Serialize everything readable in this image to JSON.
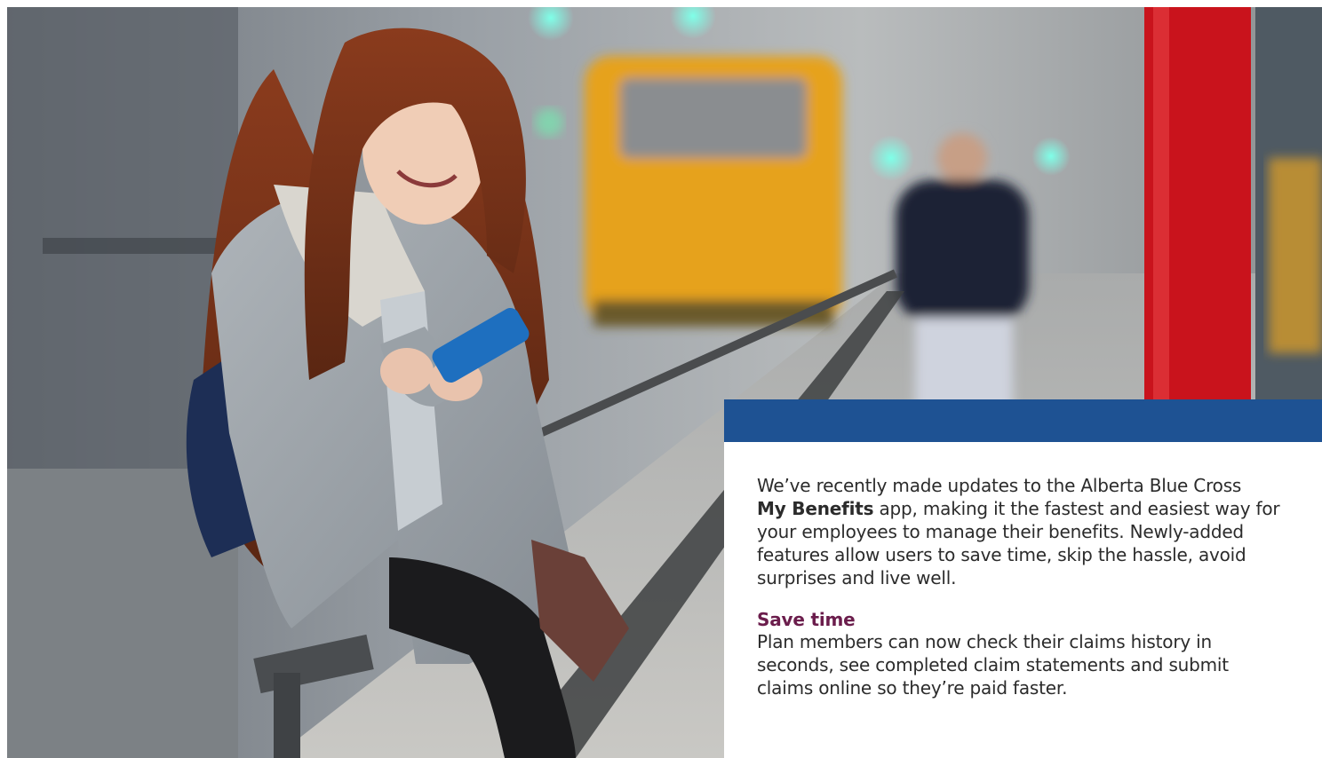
{
  "hero": {
    "image_subject": "woman-using-smartphone-photo"
  },
  "panel": {
    "bar_color": "#1e5293",
    "intro_line1": "We’ve recently made updates to the Alberta Blue Cross",
    "intro_brand": "My Benefits",
    "intro_line2_rest": " app, making it the fastest and easiest way for",
    "intro_line3": "your employees to manage their benefits. Newly-added",
    "intro_line4": "features allow users to save time, skip the hassle, avoid",
    "intro_line5": "surprises and live well.",
    "section_title": "Save time",
    "section_title_color": "#6b1d4c",
    "section_line1": "Plan members can now check their claims history in",
    "section_line2": "seconds, see completed claim statements and submit",
    "section_line3": "claims online so they’re paid faster."
  }
}
